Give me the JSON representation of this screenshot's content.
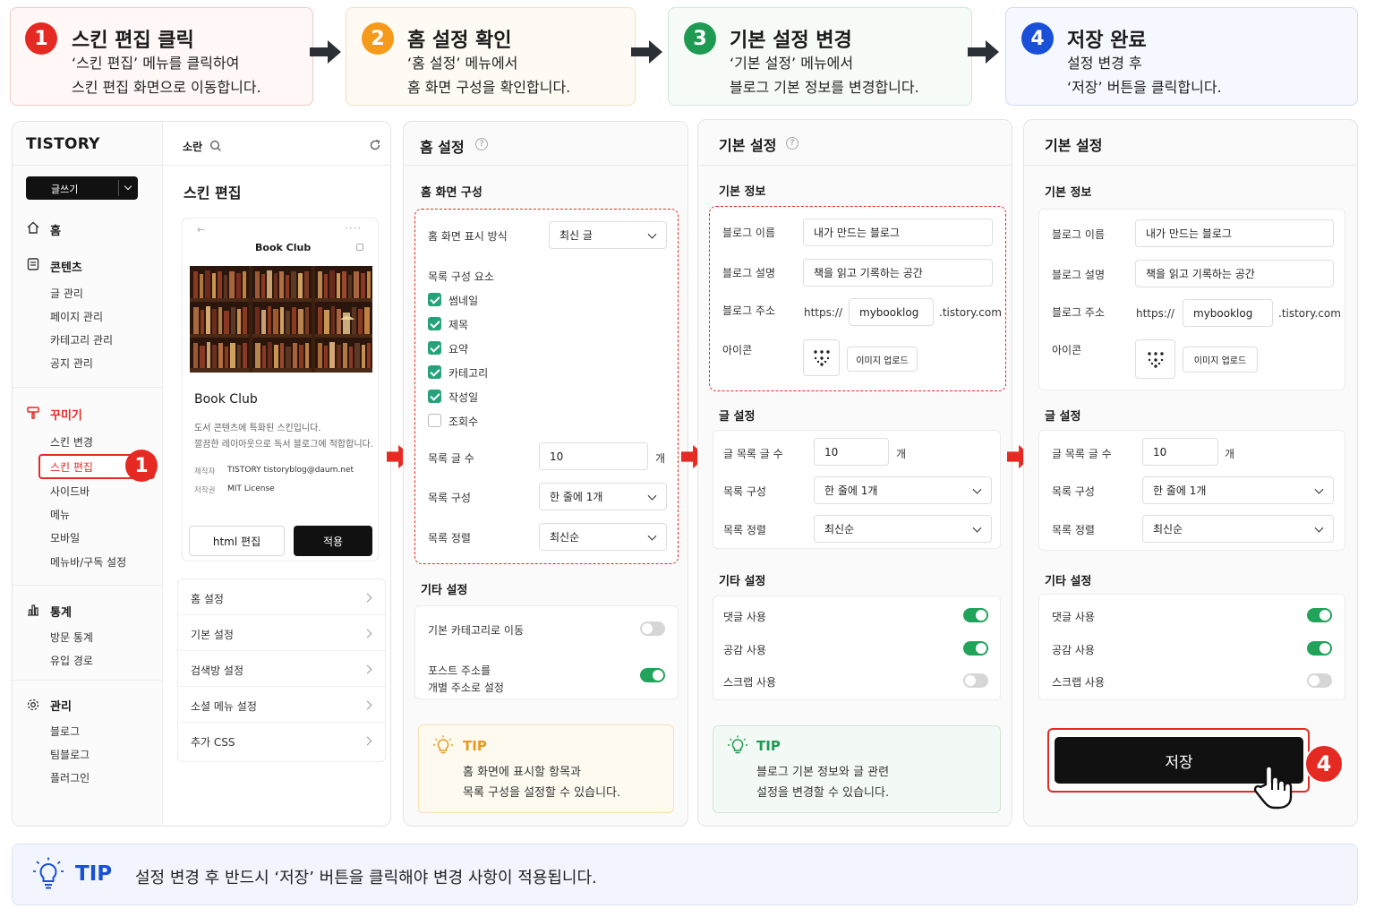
{
  "steps": [
    {
      "num": "1",
      "title": "스킨 편집 클릭",
      "desc1": "‘스킨 편집’ 메뉴를 클릭하여",
      "desc2": "스킨 편집 화면으로 이동합니다.",
      "color": "#e52a23"
    },
    {
      "num": "2",
      "title": "홈 설정 확인",
      "desc1": "‘홈 설정’ 메뉴에서",
      "desc2": "홈 화면 구성을 확인합니다.",
      "color": "#f59a1a"
    },
    {
      "num": "3",
      "title": "기본 설정 변경",
      "desc1": "‘기본 설정’ 메뉴에서",
      "desc2": "블로그 기본 정보를 변경합니다.",
      "color": "#1e9a52"
    },
    {
      "num": "4",
      "title": "저장 완료",
      "desc1": "설정 변경 후",
      "desc2": "‘저장’ 버튼을 클릭합니다.",
      "color": "#1a4fd8"
    }
  ],
  "panel1": {
    "logo": "TISTORY",
    "write_btn": "글쓰기",
    "nav": {
      "home": "홈",
      "content": "콘텐츠",
      "content_items": [
        "글 관리",
        "페이지 관리",
        "카테고리 관리",
        "공지 관리"
      ],
      "decorate": "꾸미기",
      "decorate_items": [
        "스킨 변경",
        "스킨 편집",
        "사이드바",
        "메뉴",
        "모바일",
        "메뉴바/구독 설정"
      ],
      "stats": "통계",
      "stats_items": [
        "방문 통계",
        "유입 경로"
      ],
      "manage": "관리",
      "manage_items": [
        "블로그",
        "팀블로그",
        "플러그인"
      ]
    },
    "search_label": "소란",
    "page_title": "스킨 편집",
    "skin": {
      "preview_title": "Book Club",
      "name": "Book Club",
      "desc1": "도서 콘텐츠에 특화된 스킨입니다.",
      "desc2": "깔끔한 레이아웃으로 독서 블로그에 적합합니다.",
      "maker_label": "제작자",
      "maker": "TISTORY  tistoryblog@daum.net",
      "license_label": "저작권",
      "license": "MIT License",
      "html_btn": "html 편집",
      "apply_btn": "적용"
    },
    "menu": [
      "홈 설정",
      "기본 설정",
      "검색방 설정",
      "소셜 메뉴 설정",
      "추가 CSS"
    ],
    "badge": "1"
  },
  "panel2": {
    "title": "홈 설정",
    "section": "홈 화면 구성",
    "display_label": "홈 화면 표시 방식",
    "display_value": "최신 글",
    "items_label": "목록 구성 요소",
    "items": [
      {
        "label": "썸네일",
        "on": true
      },
      {
        "label": "제목",
        "on": true
      },
      {
        "label": "요약",
        "on": true
      },
      {
        "label": "카테고리",
        "on": true
      },
      {
        "label": "작성일",
        "on": true
      },
      {
        "label": "조회수",
        "on": false
      }
    ],
    "count_label": "목록 글 수",
    "count_value": "10",
    "count_unit": "개",
    "layout_label": "목록 구성",
    "layout_value": "한 줄에 1개",
    "sort_label": "목록 정렬",
    "sort_value": "최신순",
    "etc_title": "기타 설정",
    "etc1": "기본 카테고리로 이동",
    "etc2a": "포스트 주소를",
    "etc2b": "개별 주소로 설정",
    "tip_title": "TIP",
    "tip1": "홈 화면에 표시할 항목과",
    "tip2": "목록 구성을 설정할 수 있습니다."
  },
  "panel3": {
    "title": "기본 설정",
    "section": "기본 정보",
    "name_label": "블로그 이름",
    "name_value": "내가 만드는 블로그",
    "desc_label": "블로그 설명",
    "desc_value": "책을 읽고 기록하는 공간",
    "addr_label": "블로그 주소",
    "addr_prefix": "https://",
    "addr_value": "mybooklog",
    "addr_suffix": ".tistory.com",
    "icon_label": "아이콘",
    "upload_btn": "이미지 업로드",
    "post_title": "글 설정",
    "count_label": "글 목록 글 수",
    "count_value": "10",
    "count_unit": "개",
    "layout_label": "목록 구성",
    "layout_value": "한 줄에 1개",
    "sort_label": "목록 정렬",
    "sort_value": "최신순",
    "etc_title": "기타 설정",
    "comment": "댓글 사용",
    "like": "공감 사용",
    "scrap": "스크랩 사용",
    "tip_title": "TIP",
    "tip1": "블로그 기본 정보와 글 관련",
    "tip2": "설정을 변경할 수 있습니다."
  },
  "panel4": {
    "title": "기본 설정",
    "section": "기본 정보",
    "name_label": "블로그 이름",
    "name_value": "내가 만드는 블로그",
    "desc_label": "블로그 설명",
    "desc_value": "책을 읽고 기록하는 공간",
    "addr_label": "블로그 주소",
    "addr_prefix": "https://",
    "addr_value": "mybooklog",
    "addr_suffix": ".tistory.com",
    "icon_label": "아이콘",
    "upload_btn": "이미지 업로드",
    "post_title": "글 설정",
    "count_label": "글 목록 글 수",
    "count_value": "10",
    "count_unit": "개",
    "layout_label": "목록 구성",
    "layout_value": "한 줄에 1개",
    "sort_label": "목록 정렬",
    "sort_value": "최신순",
    "etc_title": "기타 설정",
    "comment": "댓글 사용",
    "like": "공감 사용",
    "scrap": "스크랩 사용",
    "save_btn": "저장",
    "badge": "4"
  },
  "footer": {
    "tip_title": "TIP",
    "tip_text": "설정 변경 후 반드시 ‘저장’ 버튼을 클릭해야 변경 사항이 적용됩니다."
  }
}
